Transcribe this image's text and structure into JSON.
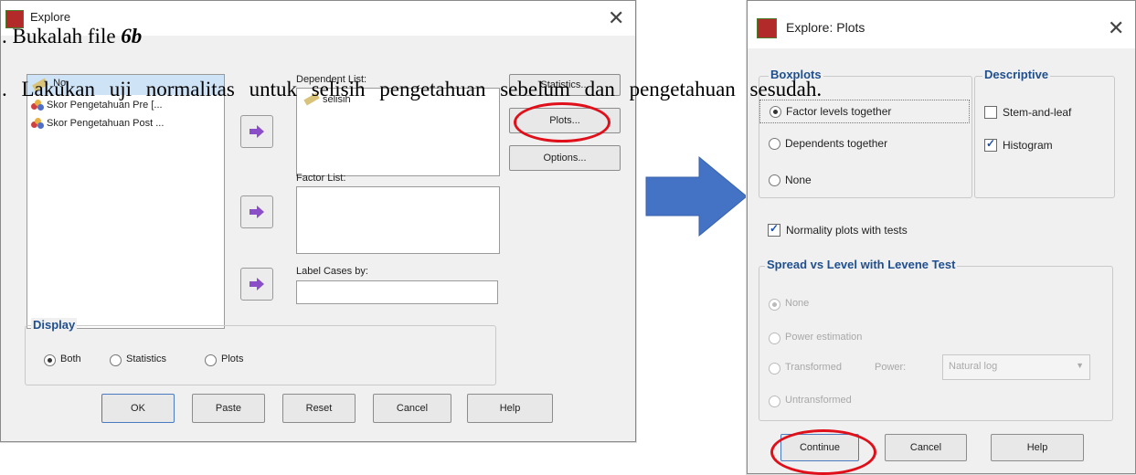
{
  "document": {
    "line1_prefix": ". ",
    "line1_text": "Bukalah file ",
    "line1_file": "6b",
    "line2_prefix": ". ",
    "line2_text": "Lakukan uji normalitas untuk selisih pengetahuan sebelum dan pengetahuan sesudah."
  },
  "explore_dialog": {
    "title": "Explore",
    "variables": [
      {
        "label": "No"
      },
      {
        "label": "Skor Pengetahuan Pre [..."
      },
      {
        "label": "Skor Pengetahuan Post ..."
      }
    ],
    "dependent_list_label": "Dependent List:",
    "dependent_items": [
      "selisih"
    ],
    "factor_list_label": "Factor List:",
    "label_cases_label": "Label Cases by:",
    "side_buttons": {
      "statistics": "Statistics...",
      "plots": "Plots...",
      "options": "Options..."
    },
    "display_group": "Display",
    "display_options": [
      {
        "label": "Both",
        "selected": true
      },
      {
        "label": "Statistics",
        "selected": false
      },
      {
        "label": "Plots",
        "selected": false
      }
    ],
    "bottom_buttons": [
      "OK",
      "Paste",
      "Reset",
      "Cancel",
      "Help"
    ]
  },
  "plots_dialog": {
    "title": "Explore: Plots",
    "boxplots_group": "Boxplots",
    "boxplots_options": [
      {
        "label": "Factor levels together",
        "selected": true
      },
      {
        "label": "Dependents together",
        "selected": false
      },
      {
        "label": "None",
        "selected": false
      }
    ],
    "descriptive_group": "Descriptive",
    "descriptive_options": [
      {
        "label": "Stem-and-leaf",
        "checked": false
      },
      {
        "label": "Histogram",
        "checked": true
      }
    ],
    "normality_label": "Normality plots with tests",
    "normality_checked": true,
    "spread_group": "Spread vs Level with Levene Test",
    "spread_options": [
      {
        "label": "None",
        "selected": true
      },
      {
        "label": "Power estimation",
        "selected": false
      },
      {
        "label": "Transformed",
        "selected": false
      },
      {
        "label": "Untransformed",
        "selected": false
      }
    ],
    "power_label": "Power:",
    "power_value": "Natural log",
    "bottom_buttons": [
      "Continue",
      "Cancel",
      "Help"
    ]
  },
  "colors": {
    "highlight_ellipse": "#e0101a",
    "flow_arrow": "#4472c4",
    "group_title": "#1f4f8f",
    "selected_item": "#cfe3f7"
  }
}
